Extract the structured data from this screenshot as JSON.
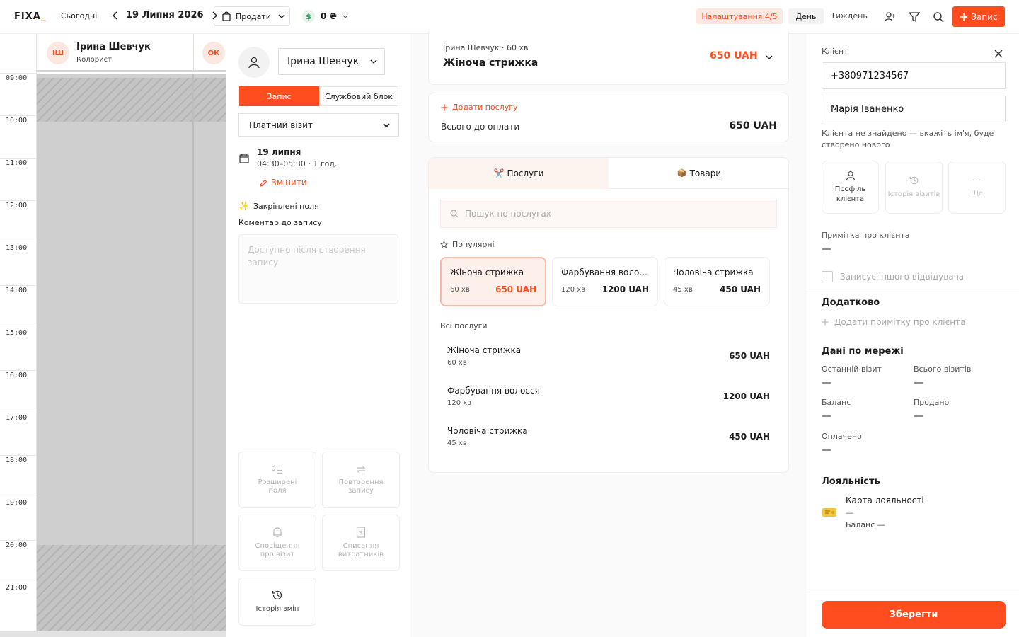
{
  "topbar": {
    "logo_a": "FI",
    "logo_b": "XA",
    "logo_c": "_",
    "today": "Сьогодні",
    "date": "19 Липня 2026",
    "sales": "Продати",
    "cash": "0 ₴",
    "setup": "Налаштування 4/5",
    "view_day": "День",
    "view_week": "Тиждень",
    "add_record": "Запис",
    "accent": "#ff4d1f"
  },
  "calendar": {
    "hours": [
      "09:00",
      "10:00",
      "11:00",
      "12:00",
      "13:00",
      "14:00",
      "15:00",
      "16:00",
      "17:00",
      "18:00",
      "19:00",
      "20:00",
      "21:00"
    ],
    "staff": [
      {
        "initials": "ІШ",
        "name": "Ірина Шевчук",
        "role": "Колорист"
      },
      {
        "initials": "ОК"
      }
    ]
  },
  "form": {
    "master": "Ірина Шевчук",
    "tab_record": "Запис",
    "tab_block": "Службовий блок",
    "visit_type": "Платний візит",
    "date": "19 липня",
    "time": "04:30–05:30 · 1 год.",
    "change": "Змінити",
    "pinned": "Закріплені поля",
    "comment_label": "Коментар до запису",
    "comment_placeholder": "Доступно після створення запису",
    "extra_fields": "Розширені поля",
    "repeat": "Повторення запису",
    "notifications": "Сповіщення про візит",
    "consumables": "Списання витратників",
    "history": "Історія змін"
  },
  "service_card": {
    "meta": "Ірина Шевчук · 60 хв",
    "name": "Жіноча стрижка",
    "price": "650 UAH"
  },
  "totals": {
    "add_service": "Додати послугу",
    "total_label": "Всього до оплати",
    "total_value": "650 UAH"
  },
  "catalog": {
    "tab_services": "Послуги",
    "tab_goods": "Товари",
    "search_placeholder": "Пошук по послугах",
    "popular_label": "Популярні",
    "popular": [
      {
        "name": "Жіноча стрижка",
        "dur": "60 хв",
        "price": "650 UAH"
      },
      {
        "name": "Фарбування воло...",
        "dur": "120 хв",
        "price": "1200 UAH"
      },
      {
        "name": "Чоловіча стрижка",
        "dur": "45 хв",
        "price": "450 UAH"
      }
    ],
    "all_label": "Всі послуги",
    "all": [
      {
        "name": "Жіноча стрижка",
        "dur": "60 хв",
        "price": "650 UAH"
      },
      {
        "name": "Фарбування волосся",
        "dur": "120 хв",
        "price": "1200 UAH"
      },
      {
        "name": "Чоловіча стрижка",
        "dur": "45 хв",
        "price": "450 UAH"
      }
    ]
  },
  "client": {
    "label": "Клієнт",
    "phone": "+380971234567",
    "name": "Марія Іваненко",
    "not_found": "Клієнта не знайдено — вкажіть ім'я, буде створено нового",
    "profile": "Профіль клієнта",
    "visit_history": "Історія візитів",
    "more": "Ще",
    "note_label": "Примітка про клієнта",
    "dash": "—",
    "other_visitor": "Записує іншого відвідувача",
    "extra_title": "Додатково",
    "add_note": "Додати примітку про клієнта",
    "network_title": "Дані по мережі",
    "last_visit": "Останній візит",
    "total_visits": "Всього візитів",
    "balance": "Баланс",
    "sold": "Продано",
    "paid": "Оплачено",
    "loyalty_title": "Лояльність",
    "loyalty_card": "Карта лояльності",
    "loyalty_balance": "Баланс —",
    "save": "Зберегти"
  }
}
